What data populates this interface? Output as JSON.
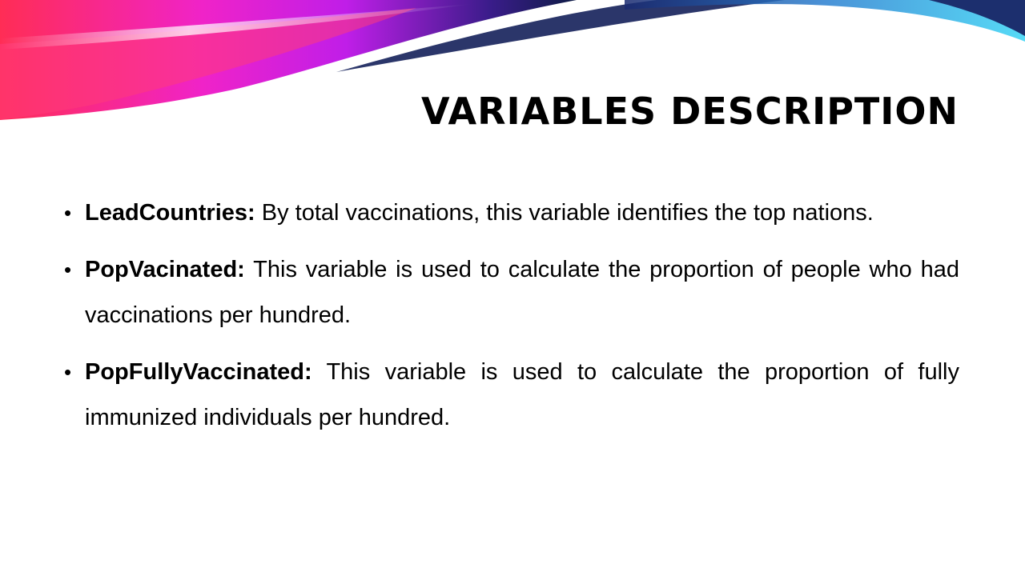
{
  "slide": {
    "title": "VARIABLES DESCRIPTION",
    "bullets": [
      {
        "term": "LeadCountries:",
        "text": "By total vaccinations, this variable identifies the top nations."
      },
      {
        "term": "PopVacinated:",
        "text": "This variable is used to calculate the proportion of people who had vaccinations per hundred."
      },
      {
        "term": "PopFullyVaccinated:",
        "text": "This variable is used to calculate the proportion of fully immunized individuals per hundred."
      }
    ]
  },
  "colors": {
    "banner_magenta": "#e81fd0",
    "banner_pink": "#ff2f8a",
    "banner_navy": "#14205a",
    "banner_cyan": "#2fc8f0",
    "text": "#000000",
    "background": "#ffffff"
  }
}
